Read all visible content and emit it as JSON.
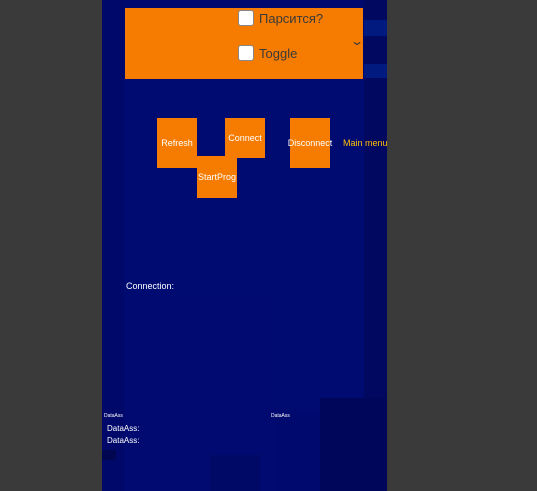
{
  "parse_toggle": {
    "label": "Парсится?",
    "checked": false
  },
  "toggle": {
    "label": "Toggle",
    "checked": false
  },
  "buttons": {
    "refresh": "Refresh",
    "connect": "Connect",
    "disconnect": "Disconnect",
    "startprog": "StartProg"
  },
  "main_menu_link": "Main menu",
  "connection_label": "Connection:",
  "data_labels": {
    "tiny_left": "DataAss",
    "tiny_right": "DataAss",
    "line1": "DataAss:",
    "line2": "DataAss:"
  },
  "colors": {
    "background_canvas": "#000a6e",
    "accent_orange": "#f57c00",
    "link_yellow": "#ffc107",
    "outer_bg": "#3a3a3a"
  }
}
